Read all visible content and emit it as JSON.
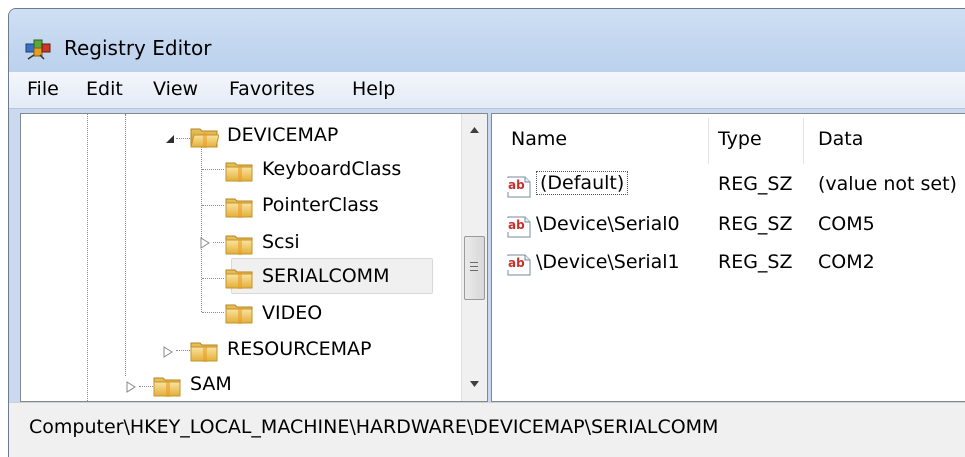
{
  "window": {
    "title": "Registry Editor",
    "icon": "registry-editor-icon"
  },
  "menu": [
    "File",
    "Edit",
    "View",
    "Favorites",
    "Help"
  ],
  "tree": {
    "nodes": [
      {
        "label": "DEVICEMAP",
        "state": "expanded",
        "icon": "folder-open-icon"
      },
      {
        "label": "KeyboardClass",
        "state": "leaf",
        "icon": "folder-icon"
      },
      {
        "label": "PointerClass",
        "state": "leaf",
        "icon": "folder-icon"
      },
      {
        "label": "Scsi",
        "state": "collapsed",
        "icon": "folder-icon"
      },
      {
        "label": "SERIALCOMM",
        "state": "leaf",
        "selected": true,
        "icon": "folder-icon"
      },
      {
        "label": "VIDEO",
        "state": "leaf",
        "icon": "folder-icon"
      },
      {
        "label": "RESOURCEMAP",
        "state": "collapsed",
        "icon": "folder-icon"
      },
      {
        "label": "SAM",
        "state": "collapsed",
        "icon": "folder-icon"
      }
    ]
  },
  "list": {
    "columns": [
      "Name",
      "Type",
      "Data"
    ],
    "rows": [
      {
        "name": "(Default)",
        "type": "REG_SZ",
        "data": "(value not set)",
        "icon": "string-value-icon"
      },
      {
        "name": "\\Device\\Serial0",
        "type": "REG_SZ",
        "data": "COM5",
        "icon": "string-value-icon"
      },
      {
        "name": "\\Device\\Serial1",
        "type": "REG_SZ",
        "data": "COM2",
        "icon": "string-value-icon"
      }
    ]
  },
  "status": {
    "path": "Computer\\HKEY_LOCAL_MACHINE\\HARDWARE\\DEVICEMAP\\SERIALCOMM"
  },
  "colors": {
    "titlebar": "#c2d6ef",
    "folder": "#e8b63c",
    "reg_icon_red": "#c8322c"
  }
}
